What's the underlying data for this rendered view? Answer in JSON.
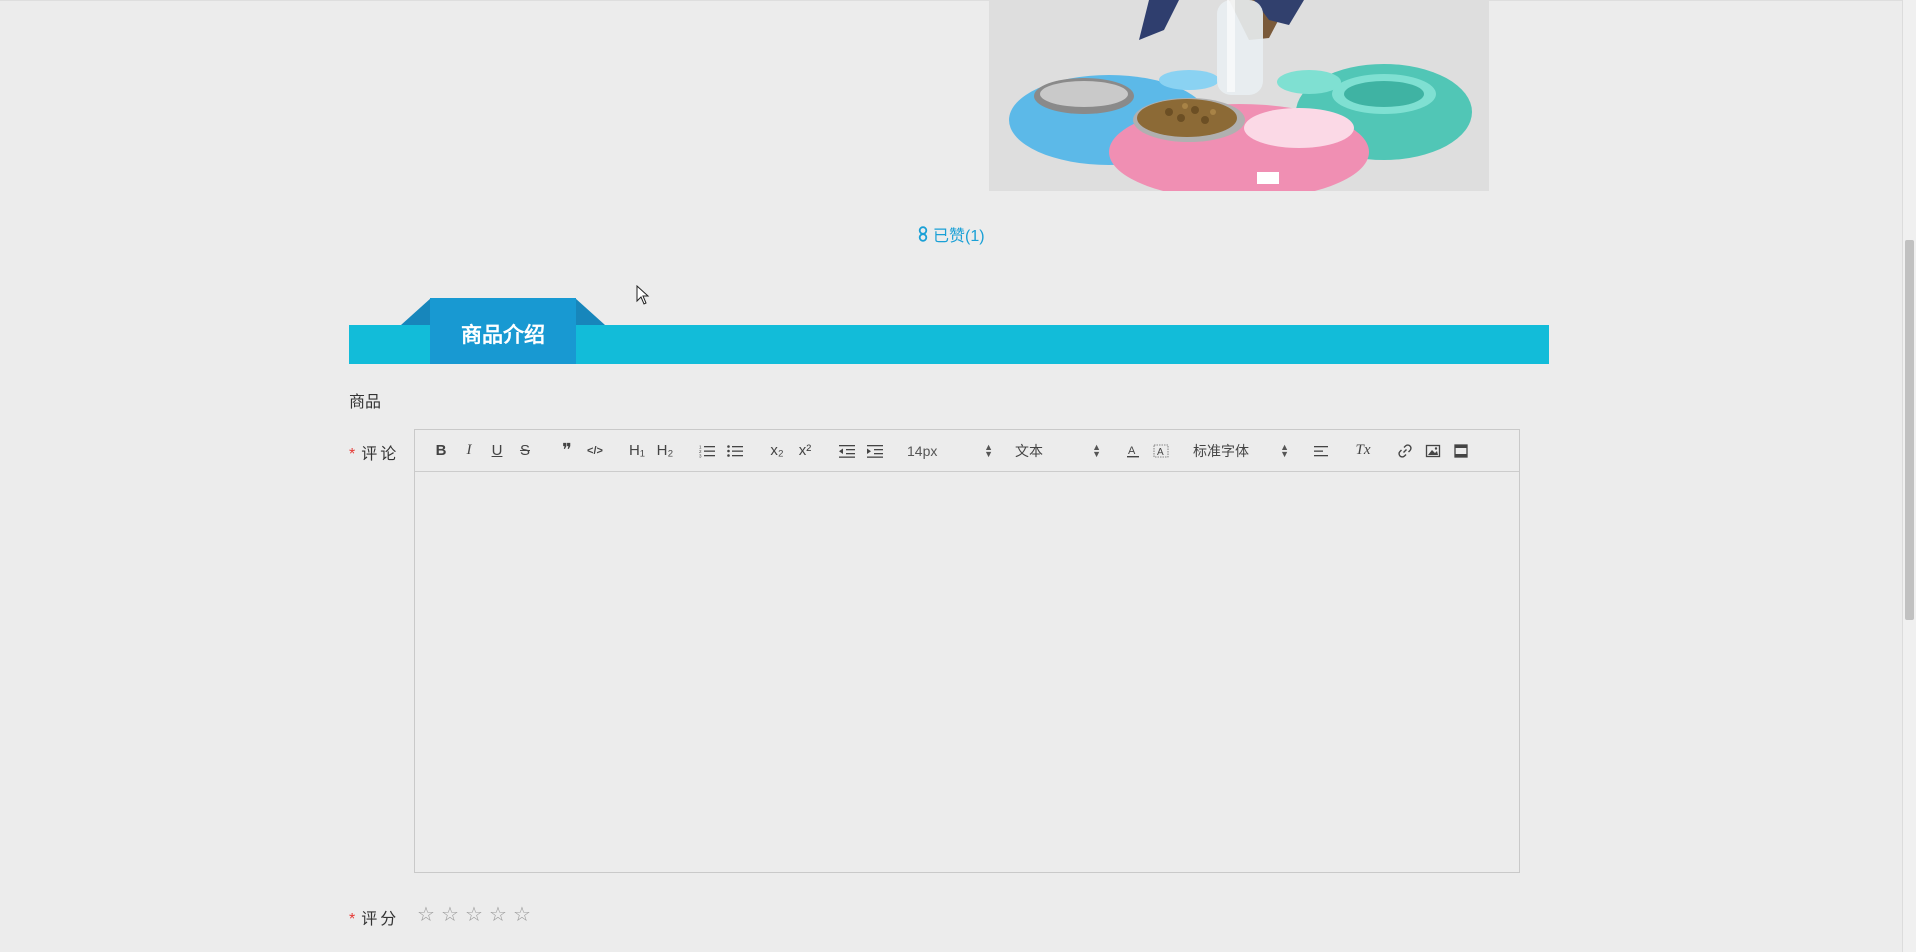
{
  "like": {
    "text": "已赞(1)"
  },
  "section": {
    "title": "商品介绍"
  },
  "product": {
    "label": "商品"
  },
  "comment": {
    "required_mark": "*",
    "label": "评论",
    "toolbar": {
      "bold": "B",
      "italic": "I",
      "underline": "U",
      "strike": "S",
      "quote": "❞",
      "code": "</>",
      "h1": "H₁",
      "h2": "H₂",
      "subscript": "x₂",
      "superscript": "x²",
      "size_select": "14px",
      "format_select": "文本",
      "font_select": "标准字体",
      "clear_format": "Tx"
    }
  },
  "rating": {
    "required_mark": "*",
    "label": "评分",
    "stars": [
      "☆",
      "☆",
      "☆",
      "☆",
      "☆"
    ],
    "value": 0
  },
  "colors": {
    "accent": "#12bcd9",
    "tab": "#1899d2",
    "link": "#1aa0d6",
    "required": "#e53935"
  }
}
